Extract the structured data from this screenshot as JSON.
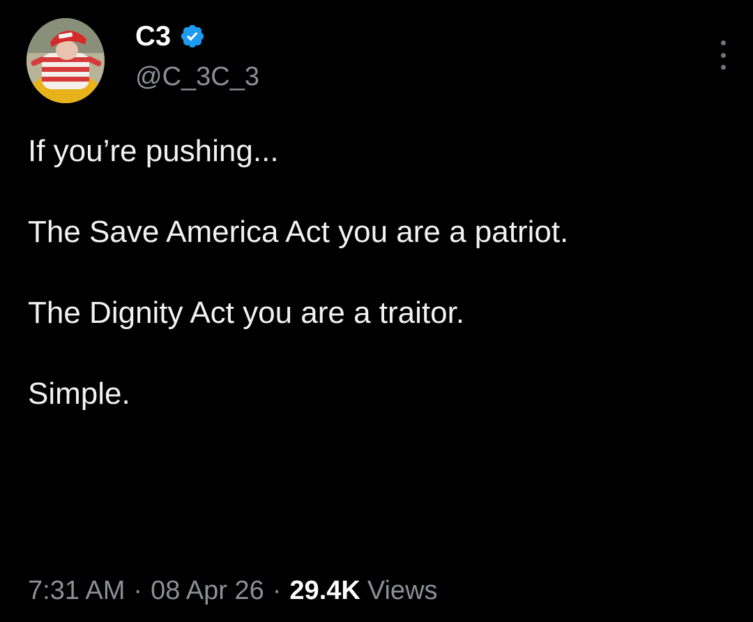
{
  "author": {
    "display_name": "C3",
    "handle": "@C_3C_3",
    "verified": true,
    "verified_color": "#1d9bf0"
  },
  "menu": {
    "icon": "more-vertical-icon"
  },
  "tweet": {
    "paragraphs": [
      "If you’re pushing...",
      "The Save America Act you are a patriot.",
      "The Dignity Act you are a traitor.",
      "Simple."
    ]
  },
  "meta": {
    "time": "7:31 AM",
    "separator": "·",
    "date": "08 Apr 26",
    "views_count": "29.4K",
    "views_label": "Views"
  },
  "colors": {
    "background": "#000000",
    "text": "#e7e9ea",
    "muted": "#8b9097"
  }
}
